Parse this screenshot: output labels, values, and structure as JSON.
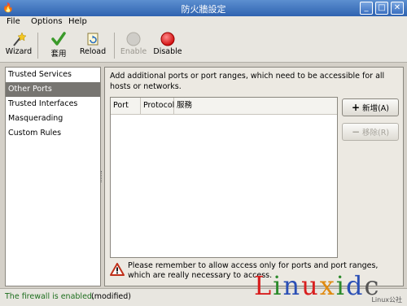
{
  "window": {
    "title": "防火牆設定",
    "app_icon": "firewall-icon"
  },
  "menu": [
    "File",
    "Options",
    "Help"
  ],
  "toolbar": {
    "wizard": "Wizard",
    "apply": "套用",
    "reload": "Reload",
    "enable": "Enable",
    "disable": "Disable"
  },
  "sidebar": {
    "items": [
      "Trusted Services",
      "Other Ports",
      "Trusted Interfaces",
      "Masquerading",
      "Custom Rules"
    ],
    "selected": "Other Ports"
  },
  "main": {
    "description": "Add additional ports or port ranges, which need to be accessible for all hosts or networks.",
    "columns": [
      "Port",
      "Protocol",
      "服務"
    ],
    "rows": [],
    "add_button": "新增(A)",
    "remove_button": "移除(R)",
    "warning": "Please remember to allow access only for ports and port ranges, which are really necessary to access."
  },
  "status": {
    "state": "The firewall is enabled.",
    "modified": "(modified)"
  },
  "watermark": {
    "text": "Linuxidc",
    "sub": "Linux公社"
  },
  "colors": {
    "titlebar": "#3f72bf",
    "selected_item": "#777571",
    "status_enabled": "#1e6f1e",
    "disable_red": "#d8181a"
  }
}
